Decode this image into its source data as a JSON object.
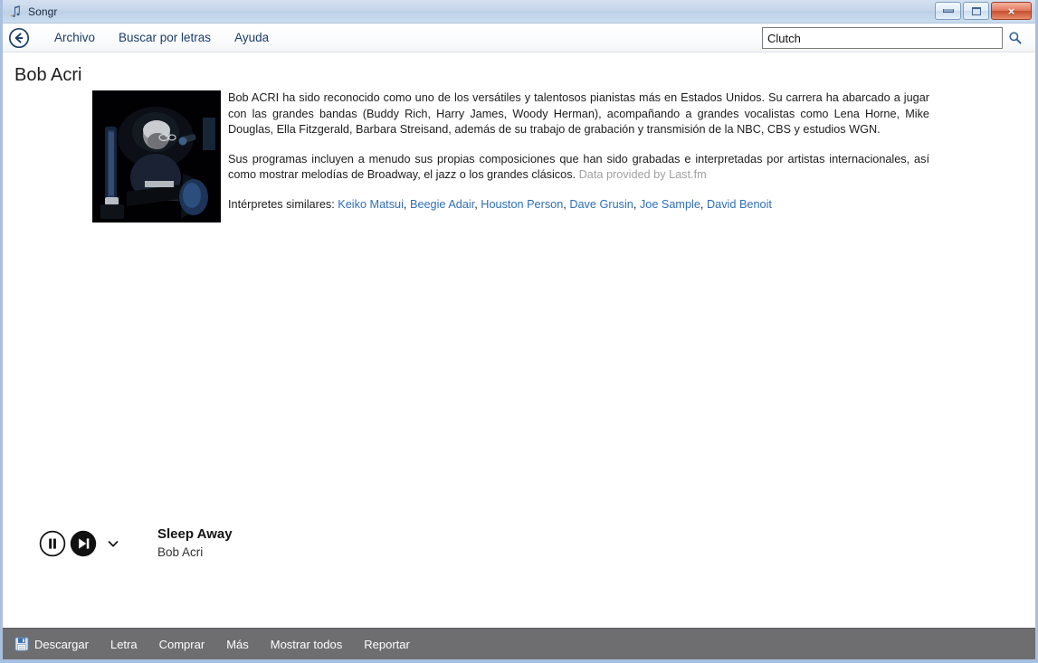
{
  "window": {
    "title": "Songr",
    "app_icon": "music-note-icon",
    "controls": {
      "minimize_label": "Minimizar",
      "maximize_label": "Maximizar",
      "close_label": "×"
    }
  },
  "toolbar": {
    "back_icon": "back-arrow-icon",
    "menu": [
      {
        "label": "Archivo"
      },
      {
        "label": "Buscar por letras"
      },
      {
        "label": "Ayuda"
      }
    ],
    "search": {
      "value": "Clutch",
      "placeholder": "",
      "icon": "search-icon"
    }
  },
  "main": {
    "artist_name": "Bob Acri",
    "photo_alt": "Bob Acri tocando el piano en un escenario oscuro",
    "bio_paragraph_1": "Bob ACRI ha sido reconocido como uno de los versátiles y talentosos pianistas más en Estados Unidos. Su carrera ha abarcado a jugar con las grandes bandas (Buddy Rich, Harry James, Woody Herman), acompañando a grandes vocalistas como Lena Horne, Mike Douglas, Ella Fitzgerald, Barbara Streisand, además de su trabajo de grabación y transmisión de la NBC, CBS y estudios WGN.",
    "bio_paragraph_2": "Sus programas incluyen a menudo sus propias composiciones que han sido grabadas e interpretadas por artistas internacionales, así como mostrar melodías de Broadway, el jazz o los grandes clásicos.",
    "bio_credit": "Data provided by Last.fm",
    "similar_label": "Intérpretes similares:",
    "similar_artists": [
      "Keiko Matsui",
      "Beegie Adair",
      "Houston Person",
      "Dave Grusin",
      "Joe Sample",
      "David Benoit"
    ]
  },
  "player": {
    "pause_label": "Pausa",
    "next_label": "Siguiente",
    "more_label": "Más opciones",
    "pause_icon": "pause-icon",
    "next_icon": "next-track-icon",
    "chevron_icon": "chevron-down-icon",
    "track_title": "Sleep Away",
    "track_artist": "Bob Acri"
  },
  "bottom_bar": {
    "items": [
      {
        "label": "Descargar",
        "icon": "save-disk-icon"
      },
      {
        "label": "Letra",
        "icon": ""
      },
      {
        "label": "Comprar",
        "icon": ""
      },
      {
        "label": "Más",
        "icon": ""
      },
      {
        "label": "Mostrar todos",
        "icon": ""
      },
      {
        "label": "Reportar",
        "icon": ""
      }
    ]
  },
  "colors": {
    "frame": "#a8c0de",
    "titlebar": "#c6d6ea",
    "menu_text": "#1b3d6b",
    "link": "#2f6fba",
    "bottom_bar": "#6e6e70",
    "close_button": "#c4502f"
  }
}
